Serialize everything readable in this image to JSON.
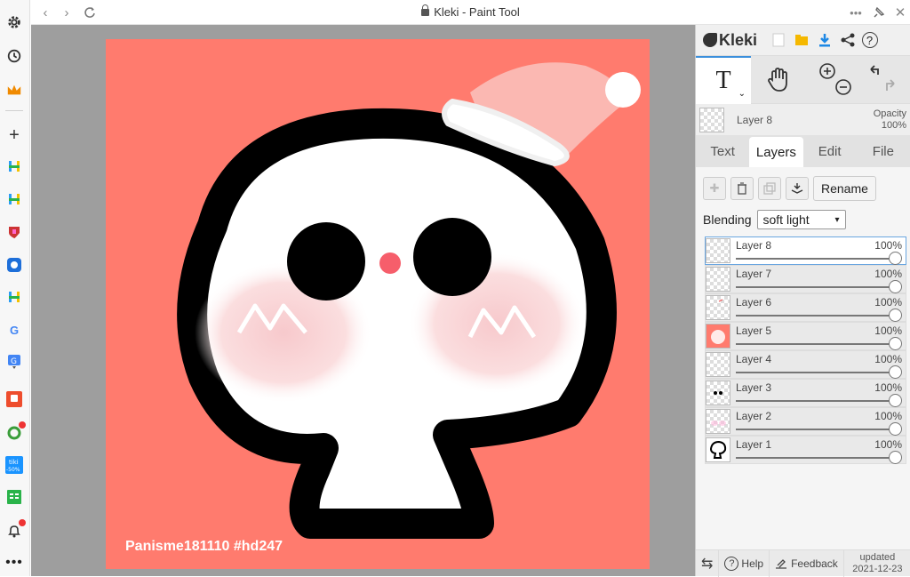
{
  "window": {
    "title": "Kleki - Paint Tool"
  },
  "sidebar": {
    "icons": [
      "gear-icon",
      "history-icon",
      "crown-icon",
      "plus-icon",
      "hotel-icon",
      "hotel-icon",
      "shield-icon",
      "bird-icon",
      "hotel-icon",
      "google-icon",
      "translate-icon",
      "shopee-icon",
      "sync-icon",
      "tiki-icon",
      "sheet-icon",
      "bell-icon",
      "more-icon"
    ],
    "tiki_label": "-50%"
  },
  "canvas": {
    "background": "#ff7b6e",
    "watermark": "Panisme181110 #hd247"
  },
  "panel": {
    "app_name": "Kleki",
    "current_layer": "Layer 8",
    "opacity_label": "Opacity",
    "opacity_value": "100%",
    "tabs": [
      "Text",
      "Layers",
      "Edit",
      "File"
    ],
    "active_tab": "Layers",
    "rename_label": "Rename",
    "blending_label": "Blending",
    "blending_value": "soft light",
    "layers": [
      {
        "name": "Layer 8",
        "opacity": "100%",
        "selected": true
      },
      {
        "name": "Layer 7",
        "opacity": "100%"
      },
      {
        "name": "Layer 6",
        "opacity": "100%"
      },
      {
        "name": "Layer 5",
        "opacity": "100%"
      },
      {
        "name": "Layer 4",
        "opacity": "100%"
      },
      {
        "name": "Layer 3",
        "opacity": "100%"
      },
      {
        "name": "Layer 2",
        "opacity": "100%"
      },
      {
        "name": "Layer 1",
        "opacity": "100%"
      }
    ],
    "footer": {
      "help": "Help",
      "feedback": "Feedback",
      "updated_label": "updated",
      "updated_date": "2021-12-23"
    }
  },
  "colors": {
    "accent": "#3b8fdc",
    "canvas_bg": "#ff7b6e",
    "download": "#1e88e5"
  }
}
